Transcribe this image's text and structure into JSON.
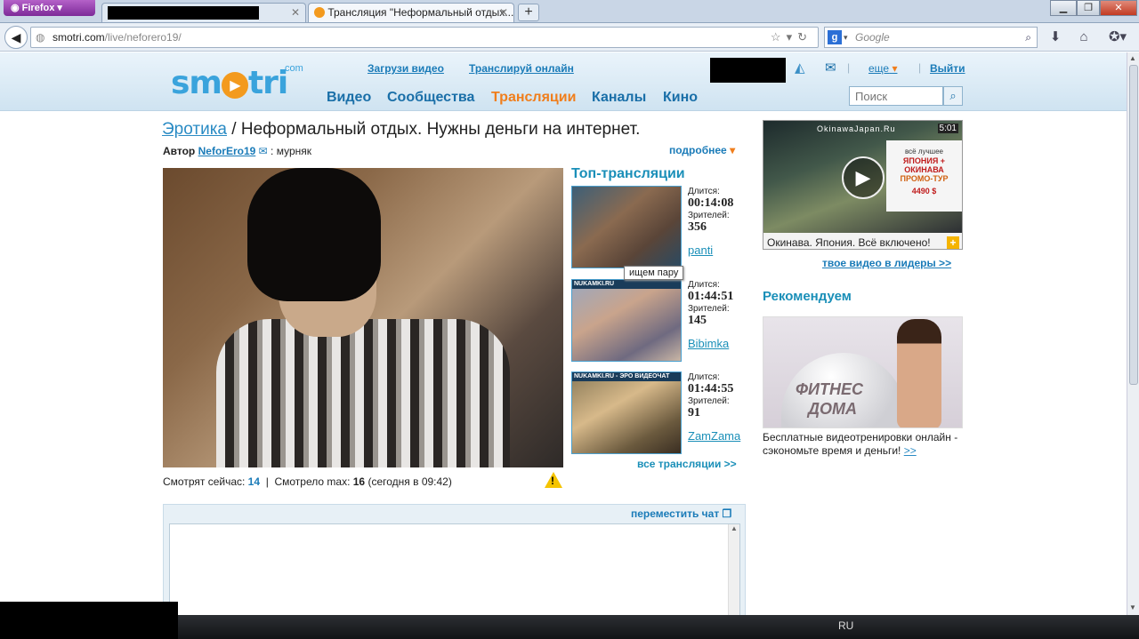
{
  "browser": {
    "app_button": "Firefox",
    "tab_active_title": "Трансляция \"Неформальный отдых...",
    "url_host": "smotri.com",
    "url_path": "/live/neforero19/",
    "search_placeholder": "Google"
  },
  "header": {
    "logo": "smotri",
    "logo_com": "com",
    "upload_link": "Загрузи видео",
    "stream_link": "Транслируй онлайн",
    "more_menu": "еще",
    "logout": "Выйти",
    "search_placeholder": "Поиск",
    "nav": [
      "Видео",
      "Сообщества",
      "Трансляции",
      "Каналы",
      "Кино"
    ]
  },
  "stream": {
    "category": "Эротика",
    "separator": " / ",
    "title": "Неформальный отдых. Нужны деньги на интернет.",
    "author_label": "Автор",
    "author": "NeforEro19",
    "author_note": ": мурняк",
    "details": "подробнее",
    "watching_label": "Смотрят сейчас:",
    "watching": "14",
    "max_label": "Смотрело max:",
    "max": "16",
    "max_when": "(сегодня в 09:42)"
  },
  "top_streams": {
    "title": "Топ-трансляции",
    "duration_label": "Длится:",
    "viewers_label": "Зрителей:",
    "items": [
      {
        "duration": "00:14:08",
        "viewers": "356",
        "user": "panti",
        "banner": ""
      },
      {
        "duration": "01:44:51",
        "viewers": "145",
        "user": "Bibimka",
        "banner": "NUKAMKI.RU"
      },
      {
        "duration": "01:44:55",
        "viewers": "91",
        "user": "ZamZama",
        "banner": "NUKAMKI.RU - ЭРО ВИДЕОЧАТ"
      }
    ],
    "tooltip": "ищем пару",
    "all_link": "все трансляции >>"
  },
  "ad": {
    "site": "OkinawaJapan.Ru",
    "time": "5:01",
    "side_line1": "всё лучшее",
    "side_line2": "ЯПОНИЯ + ОКИНАВА",
    "side_line3": "ПРОМО-ТУР",
    "side_price": "4490 $",
    "caption": "Окинава. Япония. Всё включено!",
    "leaders_link": "твое видео в лидеры >>"
  },
  "recommend": {
    "title": "Рекомендуем",
    "image_text_1": "ФИТНЕС",
    "image_text_2": "ДОМА",
    "desc": "Бесплатные видеотренировки онлайн - сэкономьте время и деньги!",
    "desc_link": ">>"
  },
  "chat": {
    "move_link": "переместить чат"
  },
  "taskbar": {
    "lang": "RU"
  }
}
